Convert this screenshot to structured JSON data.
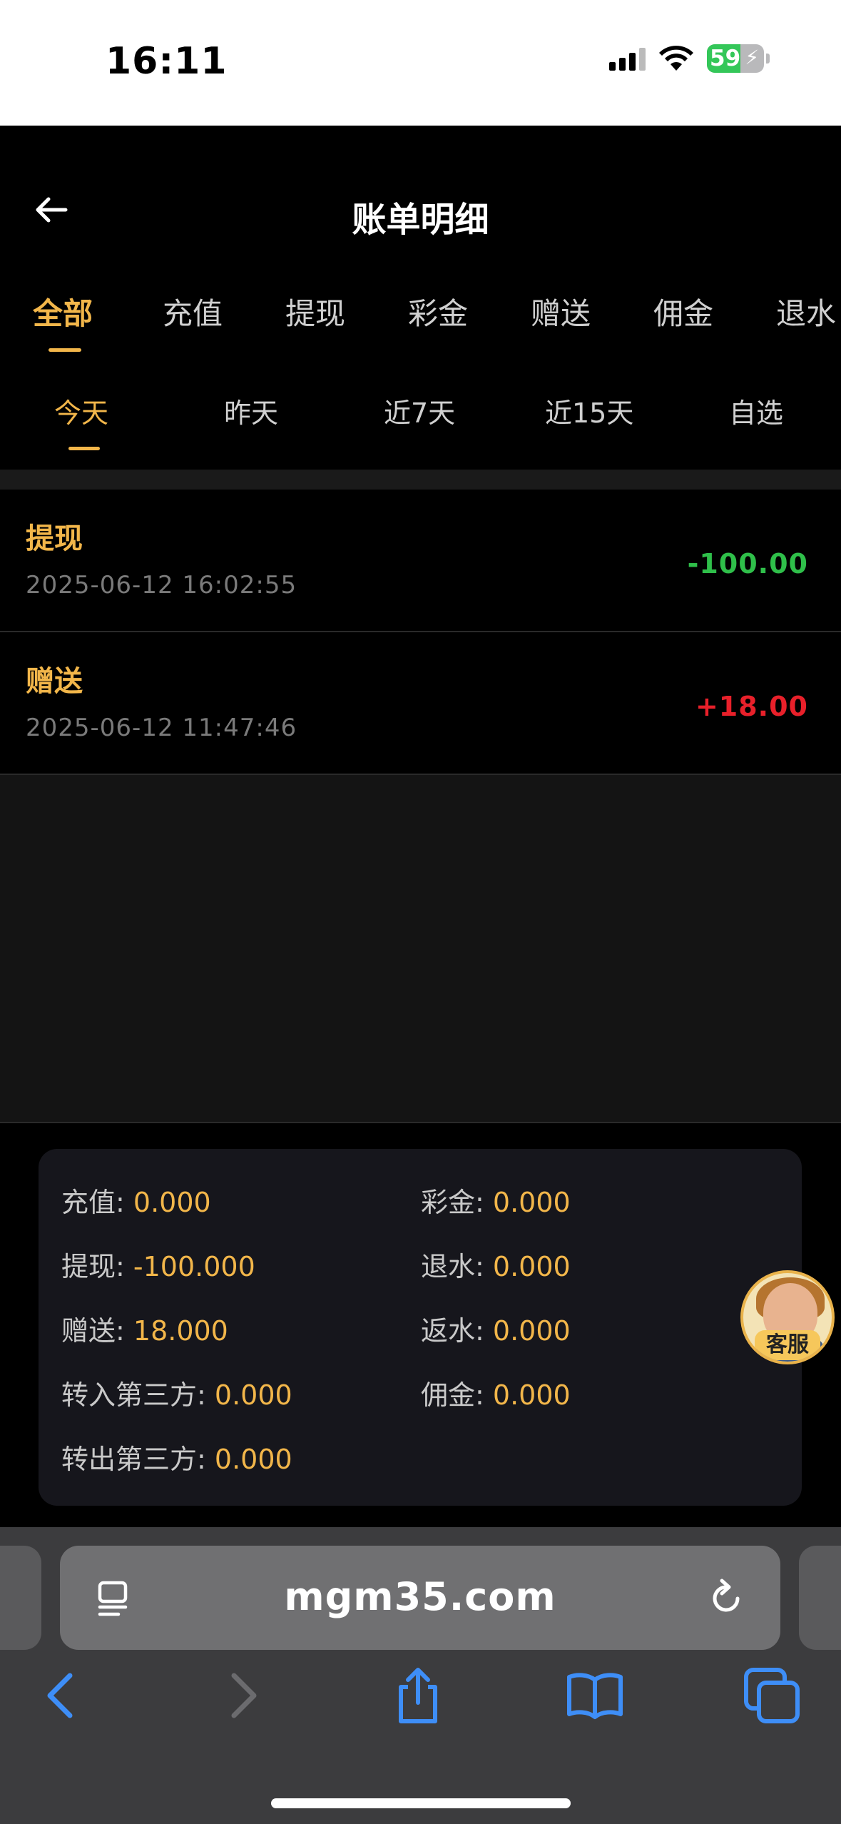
{
  "status_bar": {
    "time": "16:11",
    "battery": "59",
    "battery_level": 0.59
  },
  "header": {
    "title": "账单明细"
  },
  "category_tabs": [
    "全部",
    "充值",
    "提现",
    "彩金",
    "赠送",
    "佣金",
    "退水"
  ],
  "date_tabs": [
    "今天",
    "昨天",
    "近7天",
    "近15天",
    "自选"
  ],
  "records": [
    {
      "type": "提现",
      "time": "2025-06-12 16:02:55",
      "amount": "-100.00"
    },
    {
      "type": "赠送",
      "time": "2025-06-12 11:47:46",
      "amount": "+18.00"
    }
  ],
  "summary": {
    "recharge": {
      "label": "充值: ",
      "value": "0.000"
    },
    "bonus": {
      "label": "彩金: ",
      "value": "0.000"
    },
    "withdraw": {
      "label": "提现: ",
      "value": "-100.000"
    },
    "rebate": {
      "label": "退水: ",
      "value": "0.000"
    },
    "gift": {
      "label": "赠送: ",
      "value": "18.000"
    },
    "cashback": {
      "label": "返水: ",
      "value": "0.000"
    },
    "transfer_in": {
      "label": "转入第三方: ",
      "value": "0.000"
    },
    "commission": {
      "label": "佣金: ",
      "value": "0.000"
    },
    "transfer_out": {
      "label": "转出第三方: ",
      "value": "0.000"
    }
  },
  "support": {
    "label": "客服"
  },
  "browser": {
    "url": "mgm35.com"
  },
  "colors": {
    "accent": "#f2b64a",
    "negative": "#2fbf4a",
    "positive": "#e8202a",
    "browser_blue": "#3e8ef7"
  }
}
